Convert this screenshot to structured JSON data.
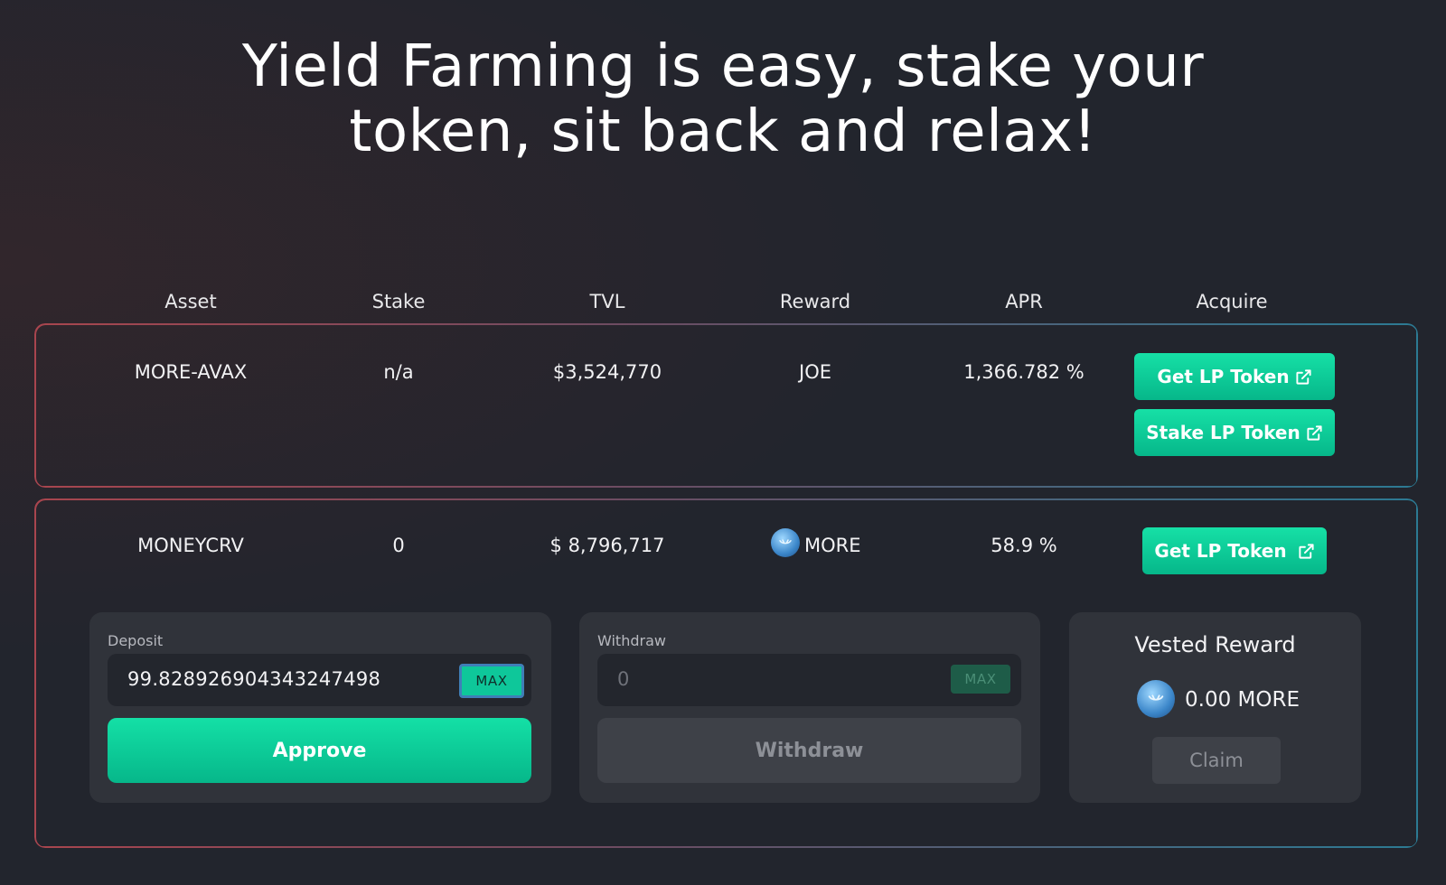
{
  "hero": {
    "line1": "Yield Farming is easy, stake your",
    "line2": "token, sit back and relax!"
  },
  "table": {
    "headers": [
      "Asset",
      "Stake",
      "TVL",
      "Reward",
      "APR",
      "Acquire"
    ],
    "rows": [
      {
        "asset": "MORE-AVAX",
        "stake": "n/a",
        "tvl": "$3,524,770",
        "reward": "JOE",
        "apr": "1,366.782 %",
        "buttons": [
          "Get LP Token",
          "Stake LP Token"
        ]
      },
      {
        "asset": "MONEYCRV",
        "stake": "0",
        "tvl": "$ 8,796,717",
        "reward": "MORE",
        "apr": "58.9 %",
        "buttons": [
          "Get LP Token"
        ]
      }
    ]
  },
  "deposit": {
    "label": "Deposit",
    "value": "99.828926904343247498",
    "max_label": "MAX",
    "button_label": "Approve"
  },
  "withdraw": {
    "label": "Withdraw",
    "value": "0",
    "max_label": "MAX",
    "button_label": "Withdraw"
  },
  "vested": {
    "title": "Vested Reward",
    "amount": "0.00 MORE",
    "claim_label": "Claim"
  },
  "icons": {
    "external_link": "external-link-icon",
    "token": "more-token-icon"
  },
  "colors": {
    "accent": "#0ec79a",
    "background": "#22252d",
    "card": "#30333a"
  }
}
